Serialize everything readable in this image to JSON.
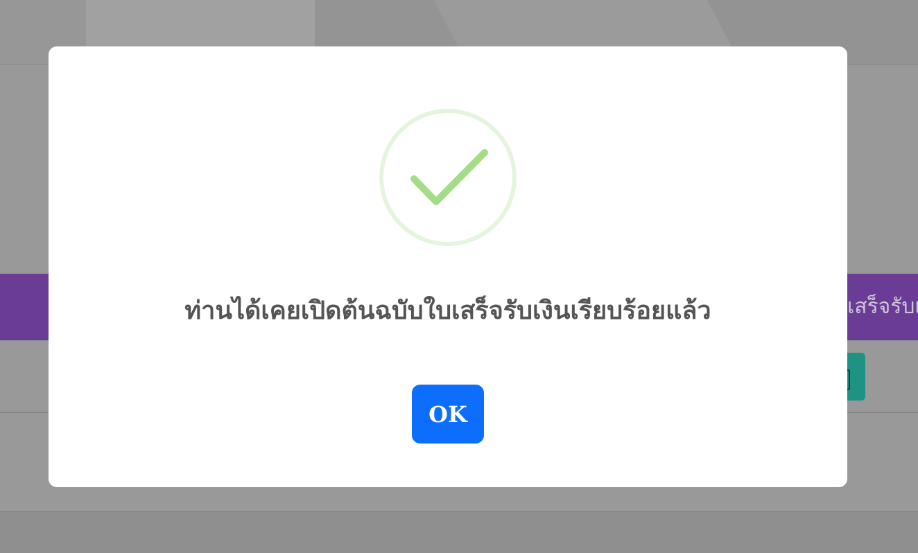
{
  "background": {
    "purple_bar_text": "เสร็จรับเงิน",
    "colors": {
      "overlay_gray": "#999999",
      "purple_bar": "#6a3c96",
      "teal_button": "#1e9384"
    }
  },
  "dialog": {
    "icon": "check-circle-icon",
    "message": "ท่านได้เคยเปิดต้นฉบับใบเสร็จรับเงินเรียบร้อยแล้ว",
    "ok_label": "OK",
    "colors": {
      "icon_ring": "#e5f4dd",
      "icon_check": "#a5dc86",
      "ok_button": "#0d6efd",
      "message_text": "#545454"
    }
  }
}
